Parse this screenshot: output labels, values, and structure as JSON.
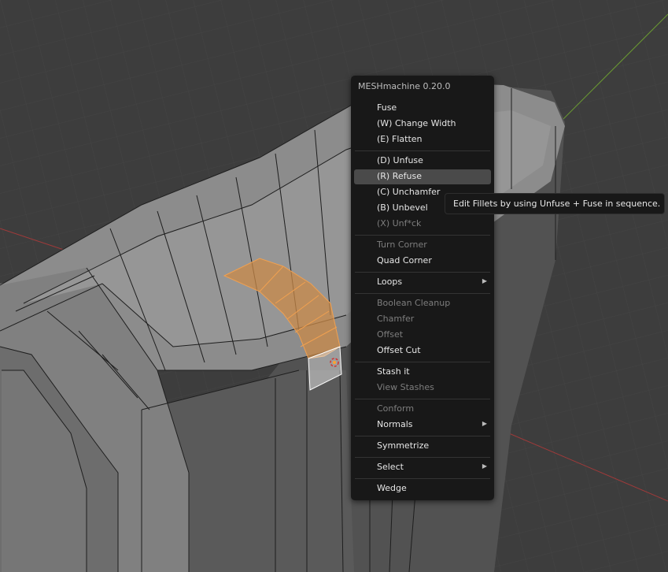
{
  "menu": {
    "title": "MESHmachine 0.20.0",
    "items": [
      {
        "label": "Fuse",
        "disabled": false
      },
      {
        "label": "(W) Change Width",
        "disabled": false
      },
      {
        "label": "(E) Flatten",
        "disabled": false
      },
      {
        "label": "(D) Unfuse",
        "disabled": false
      },
      {
        "label": "(R) Refuse",
        "disabled": false,
        "highlighted": true
      },
      {
        "label": "(C) Unchamfer",
        "disabled": false
      },
      {
        "label": "(B) Unbevel",
        "disabled": false
      },
      {
        "label": "(X) Unf*ck",
        "disabled": true
      },
      {
        "label": "Turn Corner",
        "disabled": true
      },
      {
        "label": "Quad Corner",
        "disabled": false
      },
      {
        "label": "Loops",
        "disabled": false,
        "submenu": true
      },
      {
        "label": "Boolean Cleanup",
        "disabled": true
      },
      {
        "label": "Chamfer",
        "disabled": true
      },
      {
        "label": "Offset",
        "disabled": true
      },
      {
        "label": "Offset Cut",
        "disabled": false
      },
      {
        "label": "Stash it",
        "disabled": false
      },
      {
        "label": "View Stashes",
        "disabled": true
      },
      {
        "label": "Conform",
        "disabled": true
      },
      {
        "label": "Normals",
        "disabled": false,
        "submenu": true
      },
      {
        "label": "Symmetrize",
        "disabled": false
      },
      {
        "label": "Select",
        "disabled": false,
        "submenu": true
      },
      {
        "label": "Wedge",
        "disabled": false
      }
    ]
  },
  "tooltip": {
    "text": "Edit Fillets by using Unfuse + Fuse in sequence."
  },
  "colors": {
    "selection": "#f0a050",
    "menu_bg": "#181818",
    "highlight": "#4a4a4a",
    "disabled_text": "#7d7d7d"
  },
  "icons": {
    "submenu": "triangle-right-icon"
  }
}
